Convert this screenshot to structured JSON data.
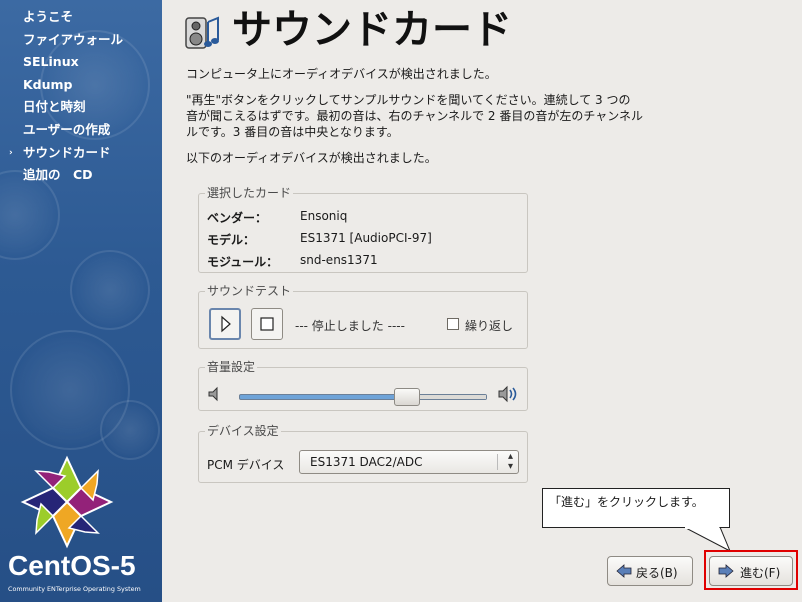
{
  "sidebar": {
    "items": [
      {
        "label": "ようこそ",
        "current": false
      },
      {
        "label": "ファイアウォール",
        "current": false
      },
      {
        "label": "SELinux",
        "current": false
      },
      {
        "label": "Kdump",
        "current": false
      },
      {
        "label": "日付と時刻",
        "current": false
      },
      {
        "label": "ユーザーの作成",
        "current": false
      },
      {
        "label": "サウンドカード",
        "current": true
      },
      {
        "label": "追加の　CD",
        "current": false
      }
    ],
    "current_marker": "›",
    "logo_text": "CentOS-5",
    "logo_tagline": "Community ENTerprise Operating System"
  },
  "header": {
    "title": "サウンドカード",
    "icon": "speaker-music-icon"
  },
  "main": {
    "intro": "コンピュータ上にオーディオデバイスが検出されました。",
    "instructions": [
      "\"再生\"ボタンをクリックしてサンプルサウンドを聞いてください。連続して 3 つの",
      "音が聞こえるはずです。最初の音は、右のチャンネルで 2 番目の音が左のチャンネル",
      "ルです。3 番目の音は中央となります。"
    ],
    "detected": "以下のオーディオデバイスが検出されました。"
  },
  "card_group": {
    "title": "選択したカード",
    "rows": [
      {
        "key": "ベンダー：",
        "value": "Ensoniq"
      },
      {
        "key": "モデル：",
        "value": "ES1371 [AudioPCI-97]"
      },
      {
        "key": "モジュール：",
        "value": "snd-ens1371"
      }
    ]
  },
  "sound_test": {
    "title": "サウンドテスト",
    "status": "--- 停止しました ----",
    "repeat_label": "繰り返し",
    "repeat_checked": false
  },
  "volume": {
    "title": "音量設定",
    "level_fraction": 0.68
  },
  "device": {
    "title": "デバイス設定",
    "pcm_label": "PCM デバイス",
    "pcm_value": "ES1371 DAC2/ADC"
  },
  "callout": {
    "text": "「進む」をクリックします。"
  },
  "buttons": {
    "back_label": "戻る(B)",
    "next_label": "進む(F)"
  },
  "colors": {
    "sidebar_bg": "#2d5a93",
    "highlight": "#e00000",
    "slider_fill": "#6ea3d8"
  }
}
